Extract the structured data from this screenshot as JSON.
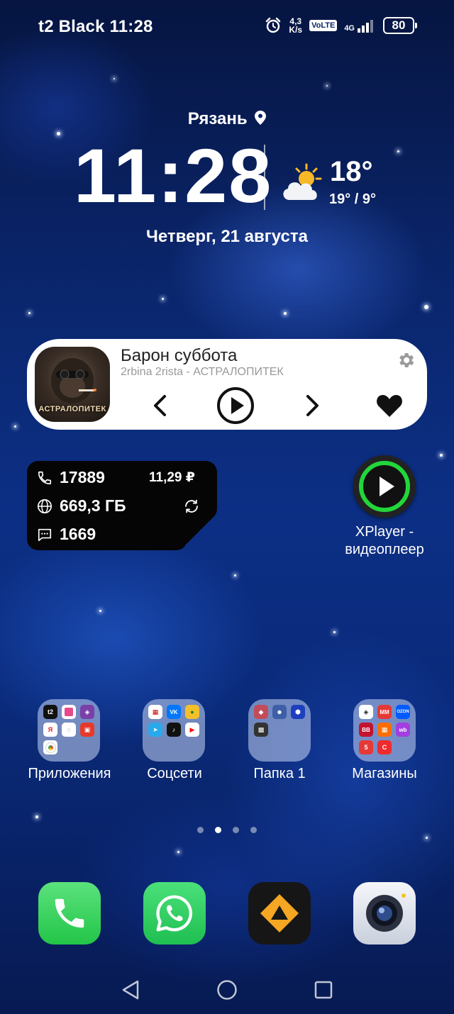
{
  "status_bar": {
    "carrier_time": "t2 Black 11:28",
    "speed_value": "4,3",
    "speed_unit": "K/s",
    "volte": "VoLTE",
    "network": "4G",
    "battery": "80",
    "icons": [
      "alarm-icon",
      "signal-icon"
    ]
  },
  "clock_widget": {
    "location": "Рязань",
    "time": "11:28",
    "temperature": "18°",
    "temp_range": "19° / 9°",
    "date": "Четверг, 21 августа",
    "weather_icon": "partly-cloudy-icon"
  },
  "music_widget": {
    "title": "Барон суббота",
    "artist": "2rbina 2rista - АСТРАЛОПИТЕК",
    "album_art_text": "АСТРАЛОПИТЕК",
    "controls": [
      "previous-icon",
      "play-icon",
      "next-icon",
      "heart-icon"
    ],
    "settings_icon": "gear-icon"
  },
  "data_widget": {
    "minutes": "17889",
    "balance": "11,29 ₽",
    "traffic": "669,3 ГБ",
    "sms": "1669"
  },
  "apps": {
    "xplayer_label": "XPlayer - видеоплеер"
  },
  "folders": [
    {
      "label": "Приложения"
    },
    {
      "label": "Соцсети"
    },
    {
      "label": "Папка 1"
    },
    {
      "label": "Магазины"
    }
  ],
  "folder_mini_labels": {
    "t2": "t2",
    "yandex": "Я",
    "vk": "VK",
    "tiktok": "♪",
    "wb": "wb",
    "vv": "ВВ",
    "ozon": "OZON",
    "mm": "MM",
    "five": "5"
  },
  "dock": [
    "phone-icon",
    "whatsapp-icon",
    "aimp-icon",
    "camera-icon"
  ],
  "navigation": [
    "back-icon",
    "home-icon",
    "recents-icon"
  ],
  "page_indicator": {
    "count": 4,
    "active": 2
  },
  "colors": {
    "wallpaper": "#0a2468",
    "xplayer_ring": "#22d63a",
    "phone_green": "#2fd158",
    "whatsapp_green": "#25d366",
    "aimp_orange": "#f5a623"
  }
}
